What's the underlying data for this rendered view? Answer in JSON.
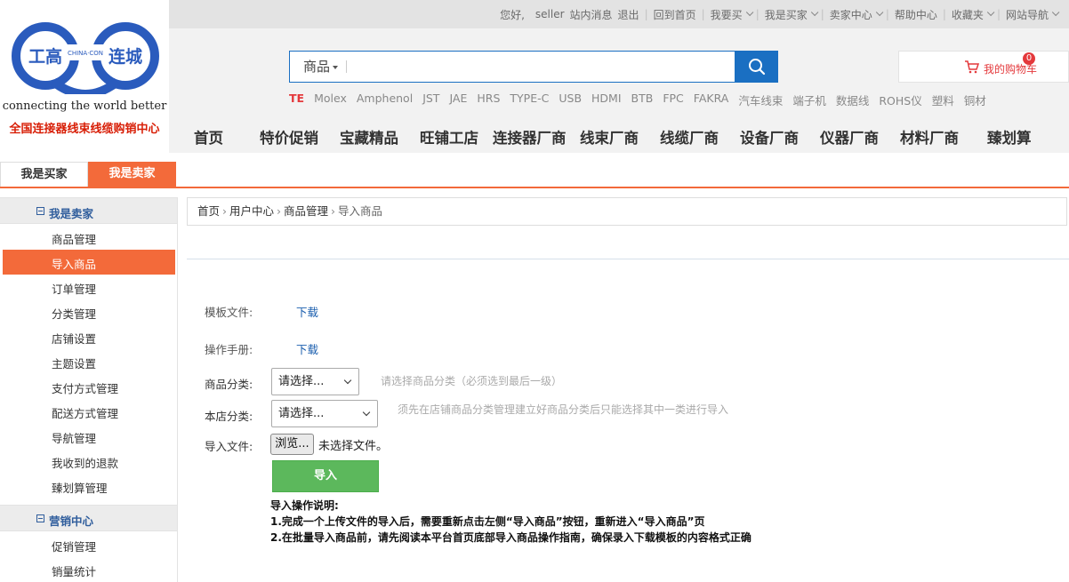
{
  "logo": {
    "left_text": "工高",
    "right_text": "连城",
    "mini_text": "CHINA·CON",
    "slogan": "connecting the world better",
    "subtitle": "全国连接器线束线缆购销中心",
    "colors": {
      "blue": "#2a5bbd",
      "red": "#d81e06"
    }
  },
  "top_nav": {
    "greeting": "您好,",
    "username": "seller",
    "messages": "站内消息",
    "logout": "退出",
    "home": "回到首页",
    "buy": "我要买",
    "buyer": "我是买家",
    "seller_center": "卖家中心",
    "help": "帮助中心",
    "favorites": "收藏夹",
    "site_nav": "网站导航"
  },
  "search": {
    "category": "商品",
    "placeholder": "",
    "hot_words": [
      "TE",
      "Molex",
      "Amphenol",
      "JST",
      "JAE",
      "HRS",
      "TYPE-C",
      "USB",
      "HDMI",
      "BTB",
      "FPC",
      "FAKRA",
      "汽车线束",
      "端子机",
      "数据线",
      "ROHS仪",
      "塑料",
      "铜材"
    ]
  },
  "cart": {
    "label": "我的购物车",
    "count": "0"
  },
  "main_nav": [
    "首页",
    "特价促销",
    "宝藏精品",
    "旺铺工店",
    "连接器厂商",
    "线束厂商",
    "线缆厂商",
    "设备厂商",
    "仪器厂商",
    "材料厂商",
    "臻划算"
  ],
  "role_tabs": {
    "buyer": "我是买家",
    "seller": "我是卖家"
  },
  "sidebar": {
    "seller_section": "我是卖家",
    "seller_items": [
      "商品管理",
      "导入商品",
      "订单管理",
      "分类管理",
      "店铺设置",
      "主题设置",
      "支付方式管理",
      "配送方式管理",
      "导航管理",
      "我收到的退款",
      "臻划算管理"
    ],
    "marketing_section": "营销中心",
    "marketing_items": [
      "促销管理",
      "销量统计"
    ]
  },
  "breadcrumb": [
    "首页",
    "用户中心",
    "商品管理",
    "导入商品"
  ],
  "form": {
    "template_label": "模板文件:",
    "template_link": "下载",
    "manual_label": "操作手册:",
    "manual_link": "下载",
    "category_label": "商品分类:",
    "category_value": "请选择...",
    "category_hint": "请选择商品分类（必须选到最后一级）",
    "store_category_label": "本店分类:",
    "store_category_value": "请选择...",
    "store_category_hint": "须先在店铺商品分类管理建立好商品分类后只能选择其中一类进行导入",
    "file_label": "导入文件:",
    "browse_label": "浏览...",
    "no_file": "未选择文件。",
    "import_button": "导入",
    "notes_title": "导入操作说明:",
    "note_1": "1.完成一个上传文件的导入后，需要重新点击左侧“导入商品”按钮，重新进入“导入商品”页",
    "note_2": "2.在批量导入商品前，请先阅读本平台首页底部导入商品操作指南，确保录入下载模板的内容格式正确"
  },
  "colors": {
    "accent": "#f36a3a",
    "link": "#1a5eae",
    "primary": "#1a6fc2",
    "success": "#5cb85c"
  }
}
